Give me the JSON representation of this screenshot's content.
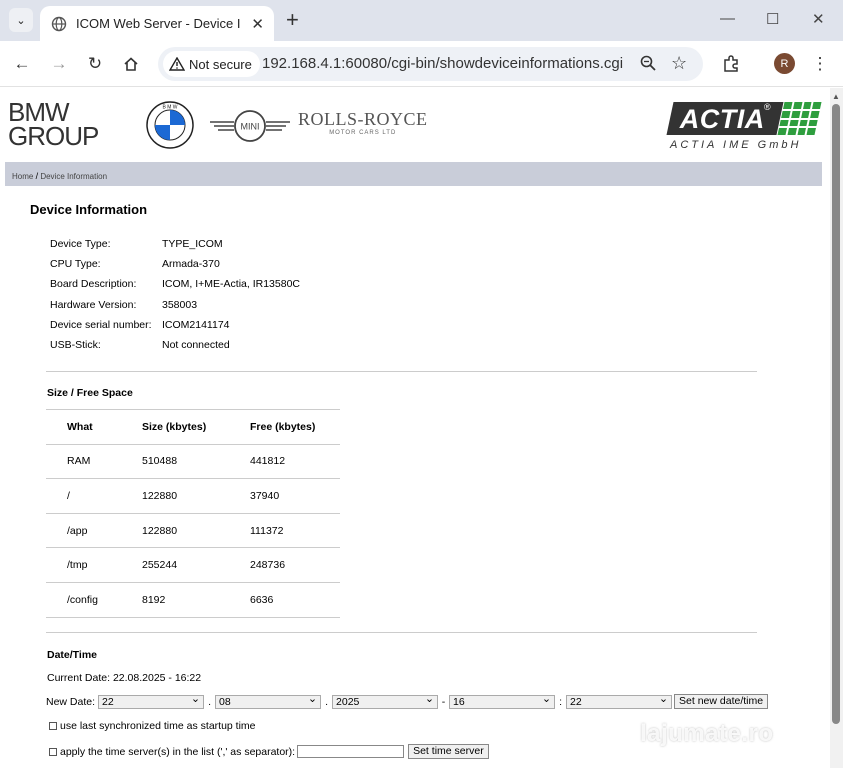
{
  "browser": {
    "tab_title": "ICOM Web Server - Device Infor",
    "security_label": "Not secure",
    "url": "192.168.4.1:60080/cgi-bin/showdeviceinformations.cgi",
    "avatar_initial": "R"
  },
  "header": {
    "bmw_group_line1": "BMW",
    "bmw_group_line2": "GROUP",
    "mini_text": "MINI",
    "rr_name": "ROLLS-ROYCE",
    "rr_sub": "MOTOR CARS LTD",
    "actia_name": "ACTIA",
    "actia_reg": "®",
    "actia_sub": "ACTIA IME GmbH"
  },
  "breadcrumb": {
    "home": "Home",
    "separator": "/",
    "current": "Device Information"
  },
  "page_title": "Device Information",
  "device_info": [
    {
      "label": "Device Type:",
      "value": "TYPE_ICOM"
    },
    {
      "label": "CPU Type:",
      "value": "Armada-370"
    },
    {
      "label": "Board Description:",
      "value": "ICOM, I+ME-Actia, IR13580C"
    },
    {
      "label": "Hardware Version:",
      "value": "358003"
    },
    {
      "label": "Device serial number:",
      "value": "ICOM2141174"
    },
    {
      "label": "USB-Stick:",
      "value": "Not connected"
    }
  ],
  "space": {
    "title": "Size / Free Space",
    "headers": [
      "What",
      "Size (kbytes)",
      "Free (kbytes)"
    ],
    "rows": [
      [
        "RAM",
        "510488",
        "441812"
      ],
      [
        "/",
        "122880",
        "37940"
      ],
      [
        "/app",
        "122880",
        "111372"
      ],
      [
        "/tmp",
        "255244",
        "248736"
      ],
      [
        "/config",
        "8192",
        "6636"
      ]
    ]
  },
  "datetime": {
    "title": "Date/Time",
    "current": "Current Date: 22.08.2025 - 16:22",
    "new_date_label": "New Date:",
    "day": "22",
    "month": "08",
    "year": "2025",
    "hour": "16",
    "minute": "22",
    "sep_dot": ".",
    "sep_dash": "-",
    "sep_colon": ":",
    "set_button": "Set new date/time",
    "sync_label": "use last synchronized time as startup time",
    "server_label": "apply the time server(s) in the list (',' as separator):",
    "server_value": "",
    "server_button": "Set time server"
  },
  "watermark": "lajumate.ro",
  "colors": {
    "actia_green": "#2e9e3e",
    "breadcrumb_bg": "#c9cdd9",
    "tabstrip_bg": "#dfe3ec"
  }
}
